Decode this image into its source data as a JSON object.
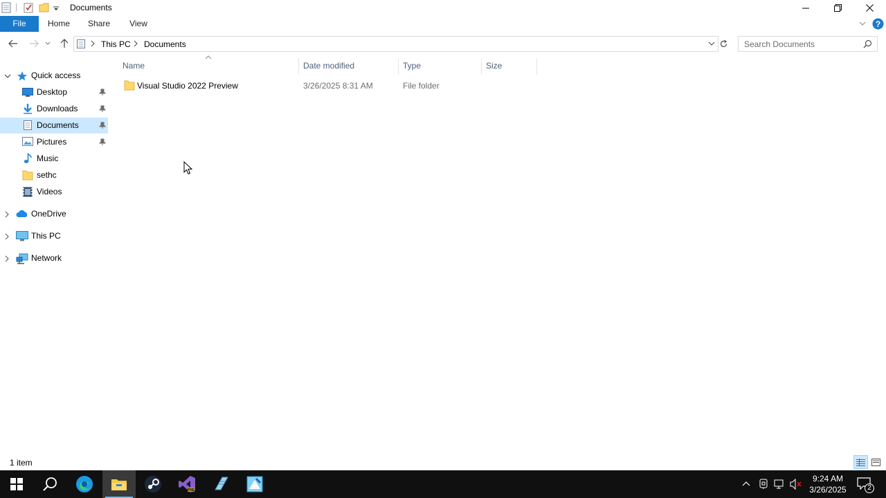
{
  "window": {
    "title": "Documents"
  },
  "ribbon": {
    "tabs": [
      "File",
      "Home",
      "Share",
      "View"
    ]
  },
  "address": {
    "breadcrumbs": [
      "This PC",
      "Documents"
    ]
  },
  "search": {
    "placeholder": "Search Documents"
  },
  "nav_pane": {
    "quick_access": "Quick access",
    "items": [
      {
        "label": "Desktop",
        "icon": "desktop-icon",
        "pinned": true
      },
      {
        "label": "Downloads",
        "icon": "downloads-icon",
        "pinned": true
      },
      {
        "label": "Documents",
        "icon": "documents-icon",
        "pinned": true,
        "selected": true
      },
      {
        "label": "Pictures",
        "icon": "pictures-icon",
        "pinned": true
      },
      {
        "label": "Music",
        "icon": "music-icon",
        "pinned": false
      },
      {
        "label": "sethc",
        "icon": "folder-icon",
        "pinned": false
      },
      {
        "label": "Videos",
        "icon": "videos-icon",
        "pinned": false
      }
    ],
    "roots": [
      {
        "label": "OneDrive",
        "icon": "onedrive-icon"
      },
      {
        "label": "This PC",
        "icon": "this-pc-icon"
      },
      {
        "label": "Network",
        "icon": "network-icon"
      }
    ]
  },
  "file_list": {
    "columns": [
      "Name",
      "Date modified",
      "Type",
      "Size"
    ],
    "rows": [
      {
        "name": "Visual Studio 2022 Preview",
        "date_modified": "3/26/2025 8:31 AM",
        "type": "File folder",
        "size": ""
      }
    ]
  },
  "status_bar": {
    "item_count": "1 item"
  },
  "taskbar": {
    "apps": [
      "start-icon",
      "search-icon",
      "edge-icon",
      "file-explorer-icon",
      "steam-icon",
      "visual-studio-icon",
      "notepad-icon",
      "paint-icon"
    ],
    "active_app": "file-explorer-icon",
    "time": "9:24 AM",
    "date": "3/26/2025",
    "notification_count": "2"
  },
  "colors": {
    "accent": "#1979ca",
    "selection": "#cce8ff",
    "taskbar": "#101010"
  }
}
